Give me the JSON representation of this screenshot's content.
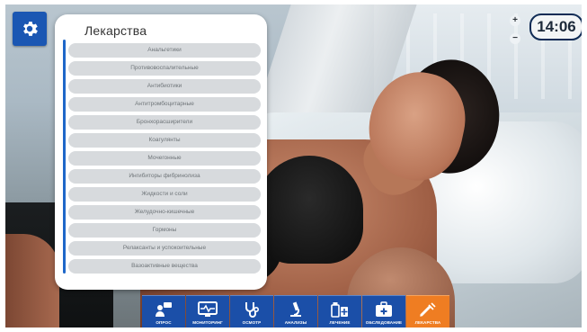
{
  "panel": {
    "title": "Лекарства",
    "items": [
      "Анальгетики",
      "Противовоспалительные",
      "Антибиотики",
      "Антитромбоцитарные",
      "Бронхорасширители",
      "Коагулянты",
      "Мочегонные",
      "Ингибиторы фибринолиза",
      "Жидкости и соли",
      "Желудочно-кишечные",
      "Гормоны",
      "Релаксанты и успокоительные",
      "Вазоактивные вещества"
    ]
  },
  "top_right": {
    "zoom_in": "+",
    "zoom_out": "−",
    "time": "14:06"
  },
  "toolbar": {
    "buttons": [
      {
        "label": "опрос",
        "icon": "interview-icon",
        "active": false
      },
      {
        "label": "мониторинг",
        "icon": "monitor-icon",
        "active": false
      },
      {
        "label": "осмотр",
        "icon": "stethoscope-icon",
        "active": false
      },
      {
        "label": "анализы",
        "icon": "microscope-icon",
        "active": false
      },
      {
        "label": "лечение",
        "icon": "medicine-icon",
        "active": false
      },
      {
        "label": "обследование",
        "icon": "medkit-icon",
        "active": false
      },
      {
        "label": "лекарства",
        "icon": "syringe-icon",
        "active": true
      }
    ]
  },
  "colors": {
    "toolbar_blue": "#1b4fa8",
    "active_orange": "#ef7d22",
    "settings_blue": "#1b57b3"
  }
}
